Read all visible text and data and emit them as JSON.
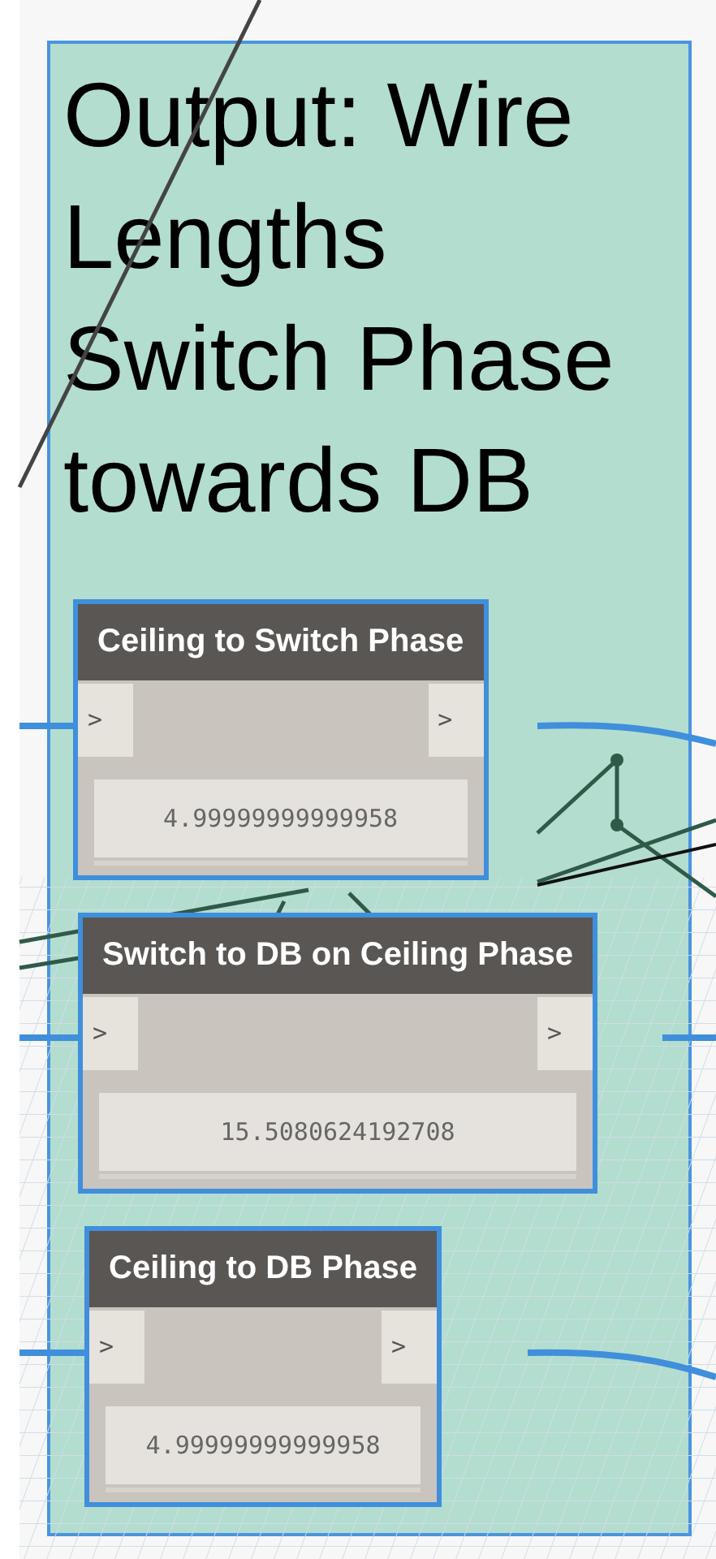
{
  "group": {
    "title": "Output: Wire Lengths Switch Phase towards DB"
  },
  "nodes": [
    {
      "title": "Ceiling to Switch Phase",
      "input_port": ">",
      "output_port": ">",
      "value": "4.99999999999958",
      "selected": true
    },
    {
      "title": "Switch to DB on Ceiling Phase",
      "input_port": ">",
      "output_port": ">",
      "value": "15.5080624192708",
      "selected": true
    },
    {
      "title": "Ceiling to DB Phase",
      "input_port": ">",
      "output_port": ">",
      "value": "4.99999999999958",
      "selected": true
    }
  ]
}
